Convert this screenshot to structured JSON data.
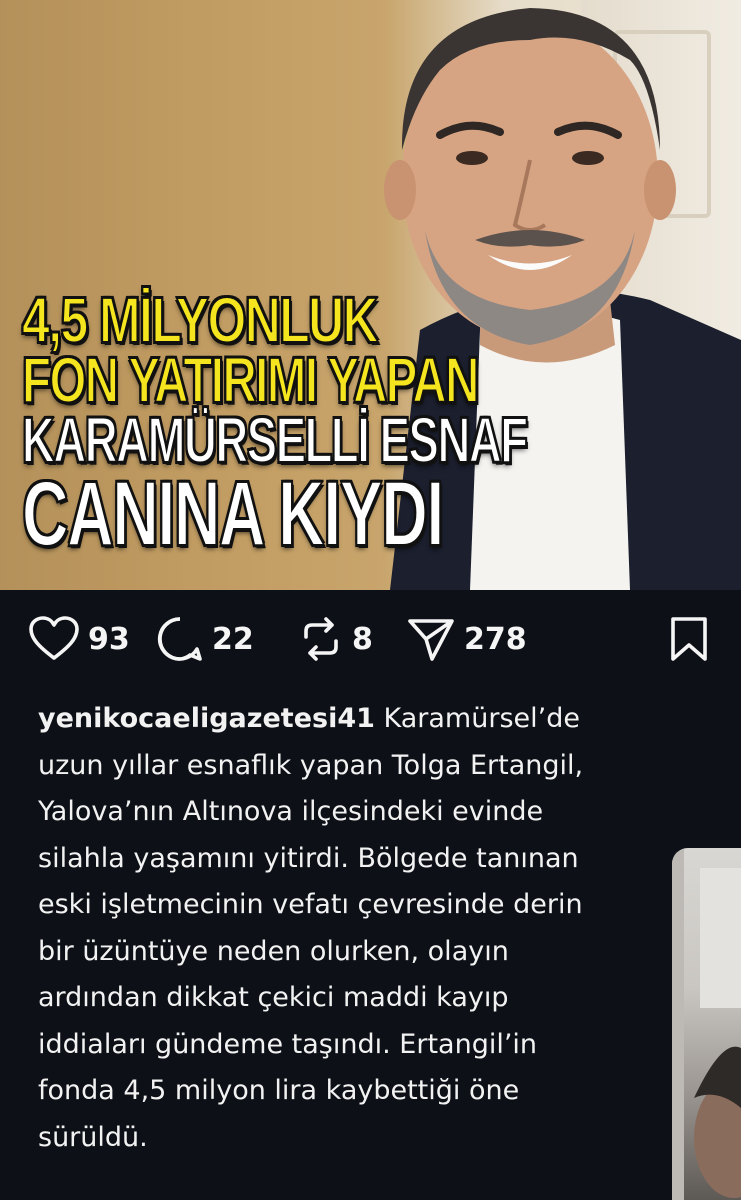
{
  "post": {
    "headline": {
      "line1": "4,5 MİLYONLUK",
      "line2": "FON YATIRIMI YAPAN",
      "line3": "KARAMÜRSELLİ ESNAF",
      "line4": "CANINA KIYDI"
    }
  },
  "actions": {
    "likes": "93",
    "comments": "22",
    "reposts": "8",
    "shares": "278"
  },
  "caption": {
    "username": "yenikocaeligazetesi41",
    "lines": [
      " Karamürsel’de",
      "uzun yıllar esnaflık yapan Tolga Ertangil,",
      "Yalova’nın Altınova ilçesindeki evinde",
      "silahla yaşamını yitirdi. Bölgede tanınan",
      "eski işletmecinin vefatı çevresinde derin",
      "bir üzüntüye neden olurken, olayın",
      "ardından dikkat çekici maddi kayıp",
      "iddiaları gündeme taşındı. Ertangil’in",
      "fonda 4,5 milyon lira kaybettiği öne",
      "sürüldü."
    ]
  },
  "icons": {
    "like": "heart-icon",
    "comment": "comment-icon",
    "repost": "repost-icon",
    "share": "send-icon",
    "save": "bookmark-icon"
  },
  "colors": {
    "background": "#0d1117",
    "headline_yellow": "#f4e51f",
    "text": "#f2f2f2"
  }
}
